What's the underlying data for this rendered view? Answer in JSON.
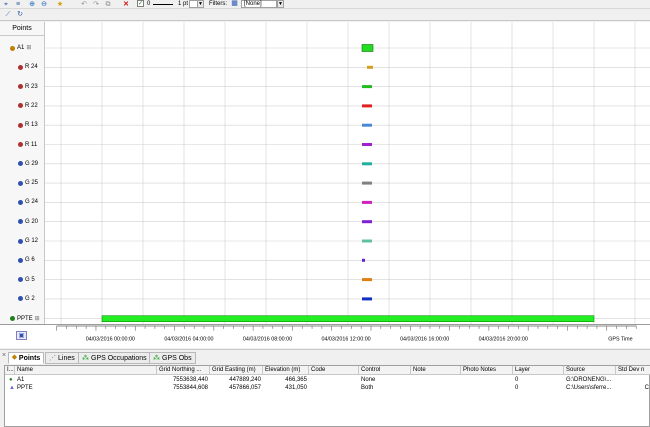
{
  "toolbar": {
    "line_width_value": "0",
    "line_style_value": "1 pt",
    "filters_label": "Filters:",
    "filter_value": "[None]"
  },
  "left_panel": {
    "header": "Points",
    "rows": [
      {
        "label": "A1",
        "expander": "⊞",
        "icon_color": "#c08000",
        "bar_color": "#22dd22",
        "bar_kind": "box"
      },
      {
        "label": "R 24",
        "icon_color": "#b03030",
        "bar_color": "#d4a020"
      },
      {
        "label": "R 23",
        "icon_color": "#b03030",
        "bar_color": "#22bb22"
      },
      {
        "label": "R 22",
        "icon_color": "#b03030",
        "bar_color": "#e02020"
      },
      {
        "label": "R 13",
        "icon_color": "#b03030",
        "bar_color": "#4a8ad4"
      },
      {
        "label": "R 11",
        "icon_color": "#b03030",
        "bar_color": "#a020d0"
      },
      {
        "label": "G 29",
        "icon_color": "#3050b0",
        "bar_color": "#20b0a0"
      },
      {
        "label": "G 25",
        "icon_color": "#3050b0",
        "bar_color": "#808080"
      },
      {
        "label": "G 24",
        "icon_color": "#3050b0",
        "bar_color": "#d020c0"
      },
      {
        "label": "G 20",
        "icon_color": "#3050b0",
        "bar_color": "#8020d0"
      },
      {
        "label": "G 12",
        "icon_color": "#3050b0",
        "bar_color": "#60c0a0"
      },
      {
        "label": "G 6",
        "icon_color": "#3050b0",
        "bar_color": "#6020e0"
      },
      {
        "label": "G 5",
        "icon_color": "#3050b0",
        "bar_color": "#e08010"
      },
      {
        "label": "G 2",
        "icon_color": "#3050b0",
        "bar_color": "#1030c0"
      },
      {
        "label": "PPTE",
        "expander": "⊞",
        "icon_color": "#208020",
        "bar_color": "#22ee22",
        "bar_kind": "long"
      }
    ]
  },
  "axis": {
    "ticks": [
      "04/03/2016 00:00:00",
      "04/03/2016 04:00:00",
      "04/03/2016 08:00:00",
      "04/03/2016 12:00:00",
      "04/03/2016 16:00:00",
      "04/03/2016 20:00:00"
    ],
    "axis_title": "GPS Time"
  },
  "tabs": [
    {
      "label": "Points",
      "icon": "points-icon",
      "active": true
    },
    {
      "label": "Lines",
      "icon": "lines-icon"
    },
    {
      "label": "GPS Occupations",
      "icon": "gps-occupations-icon"
    },
    {
      "label": "GPS Obs",
      "icon": "gps-obs-icon"
    }
  ],
  "table": {
    "columns": [
      "I...",
      "Name",
      "Grid Northing ...",
      "Grid Easting (m)",
      "Elevation (m)",
      "Code",
      "Control",
      "Note",
      "Photo Notes",
      "Layer",
      "Source",
      "Std Dev n"
    ],
    "rows": [
      {
        "icon_color": "#208020",
        "name": "A1",
        "northing": "7553638,440",
        "easting": "447889,240",
        "elevation": "466,365",
        "code": "",
        "control": "None",
        "note": "",
        "photo": "",
        "layer": "0",
        "source": "G:\\DRONENG\\...",
        "std": ""
      },
      {
        "icon_color": "#6a6ad0",
        "name": "PPTE",
        "northing": "7553844,608",
        "easting": "457866,057",
        "elevation": "431,050",
        "code": "",
        "control": "Both",
        "note": "",
        "photo": "",
        "layer": "0",
        "source": "C:\\Users\\sferre...",
        "std": "C"
      }
    ]
  }
}
